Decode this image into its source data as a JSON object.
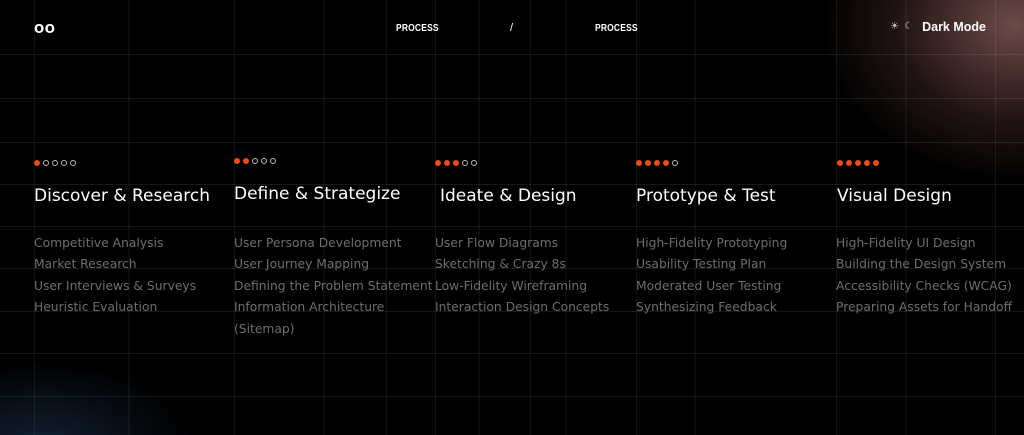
{
  "header": {
    "logo": "OO",
    "breadcrumb": [
      "PROCESS",
      "PROCESS"
    ],
    "separator": "/",
    "mode_label": "Dark Mode",
    "mode_icons": [
      "sun-icon",
      "moon-icon"
    ]
  },
  "colors": {
    "accent": "#ee4b1b",
    "text_muted": "#6e6e6e",
    "background": "#000000"
  },
  "stages": [
    {
      "title": "Discover & Research",
      "filled": 1,
      "total": 5,
      "items": [
        "Competitive Analysis",
        "Market Research",
        "User Interviews & Surveys",
        "Heuristic Evaluation"
      ]
    },
    {
      "title": "Define & Strategize",
      "filled": 2,
      "total": 5,
      "items": [
        "User Persona Development",
        "User Journey Mapping",
        "Defining the Problem Statement",
        "Information Architecture (Sitemap)"
      ]
    },
    {
      "title": "Ideate & Design",
      "filled": 3,
      "total": 5,
      "items": [
        "User Flow Diagrams",
        "Sketching & Crazy 8s",
        "Low-Fidelity Wireframing",
        "Interaction Design Concepts"
      ]
    },
    {
      "title": "Prototype & Test",
      "filled": 4,
      "total": 5,
      "items": [
        "High-Fidelity Prototyping",
        "Usability Testing Plan",
        "Moderated User Testing",
        "Synthesizing Feedback"
      ]
    },
    {
      "title": "Visual Design",
      "filled": 5,
      "total": 5,
      "items": [
        "High-Fidelity UI Design",
        "Building the Design System",
        "Accessibility Checks (WCAG)",
        "Preparing Assets for Handoff"
      ]
    }
  ]
}
